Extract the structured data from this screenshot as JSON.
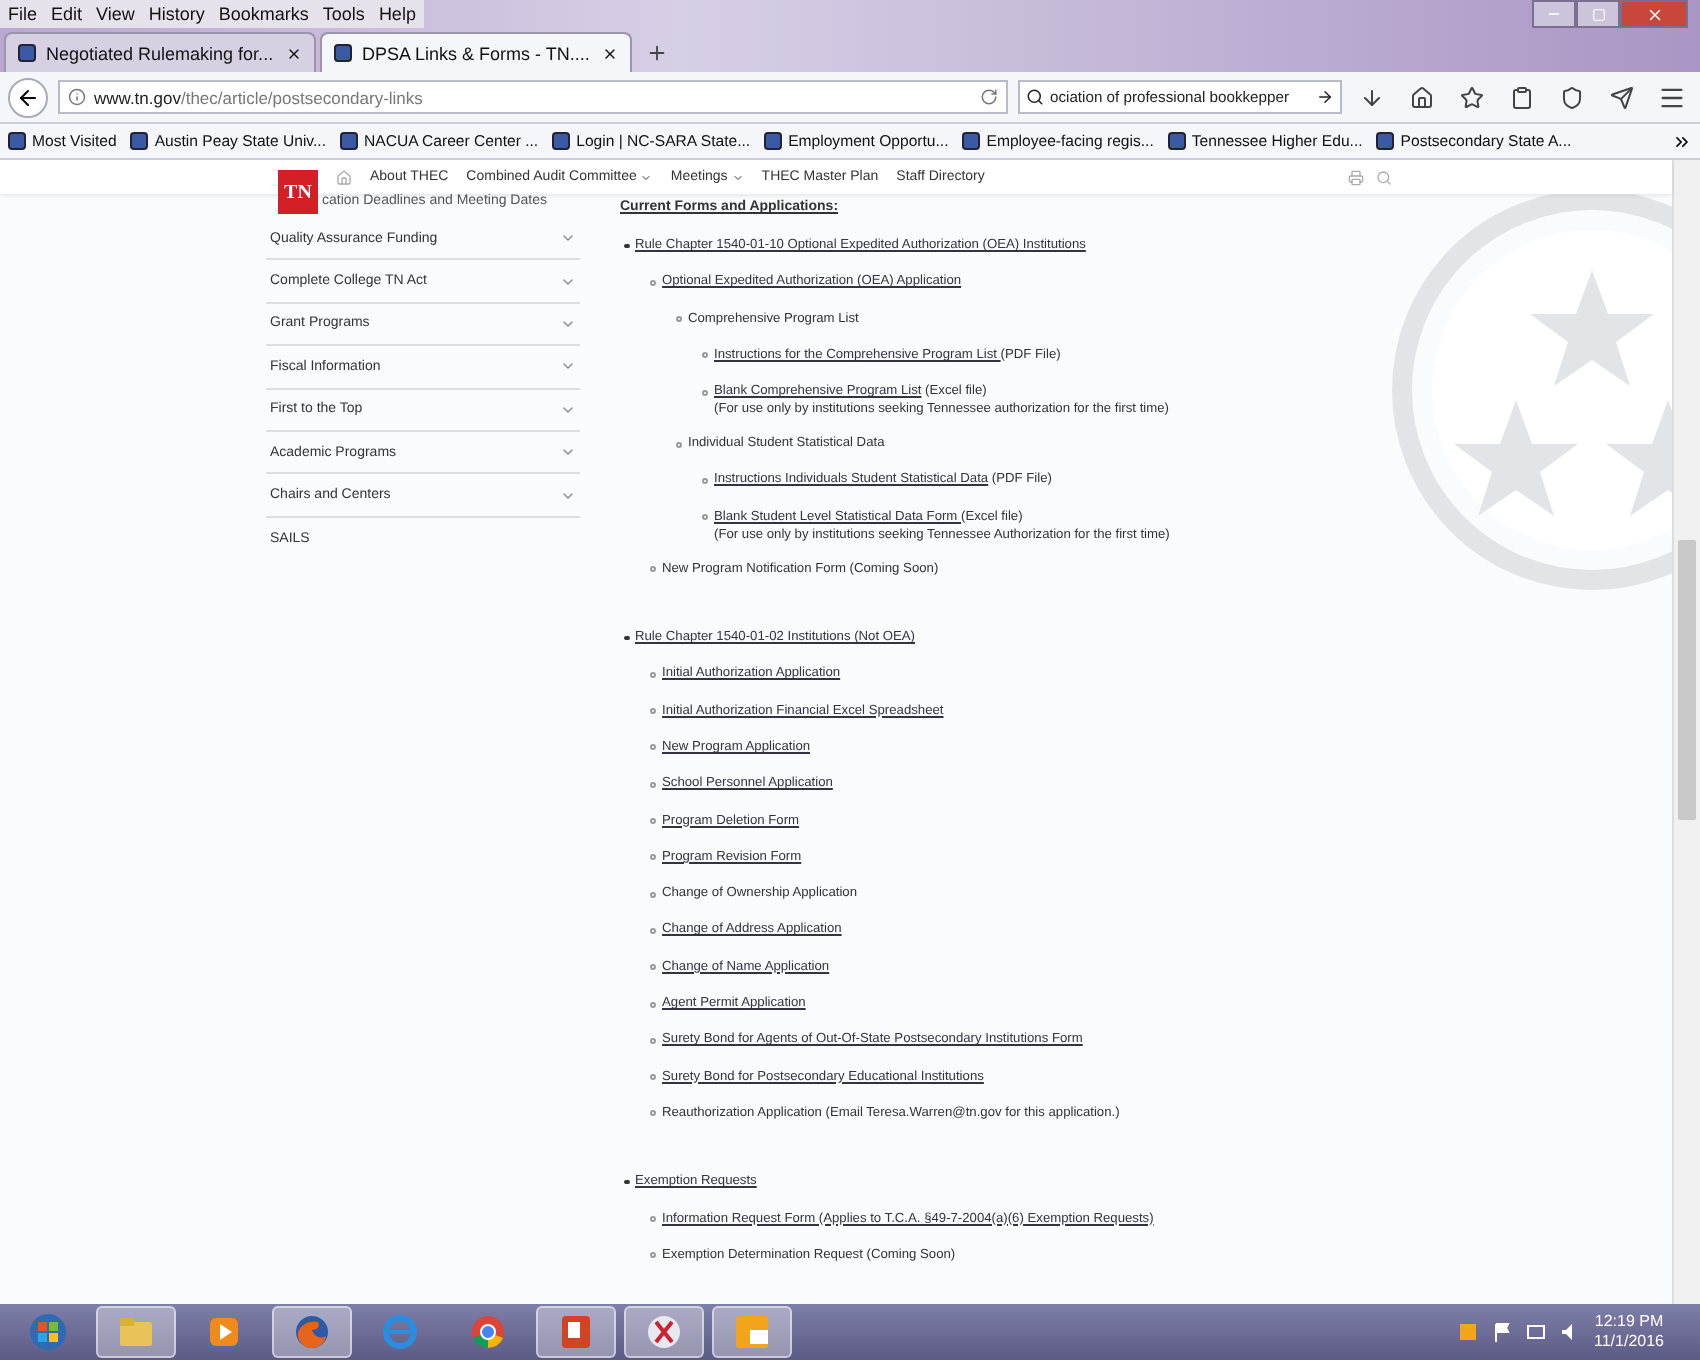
{
  "menu": [
    "File",
    "Edit",
    "View",
    "History",
    "Bookmarks",
    "Tools",
    "Help"
  ],
  "tabs": [
    {
      "label": "Negotiated Rulemaking for...",
      "selected": false
    },
    {
      "label": "DPSA Links & Forms - TN....",
      "selected": true
    }
  ],
  "address": {
    "url_host": "www.tn.gov",
    "url_path": "/thec/article/postsecondary-links",
    "search": "ociation of professional bookkepper"
  },
  "bookmarks": [
    "Most Visited",
    "Austin Peay State Univ...",
    "NACUA Career Center ...",
    "Login | NC-SARA State...",
    "Employment Opportu...",
    "Employee-facing regis...",
    "Tennessee Higher Edu...",
    "Postsecondary State A..."
  ],
  "site": {
    "logo": "TN",
    "nav": [
      {
        "label": "About THEC",
        "dropdown": false
      },
      {
        "label": "Combined Audit Committee",
        "dropdown": true
      },
      {
        "label": "Meetings",
        "dropdown": true
      },
      {
        "label": "THEC Master Plan",
        "dropdown": false
      },
      {
        "label": "Staff Directory",
        "dropdown": false
      }
    ]
  },
  "sidebar": [
    {
      "label": "cation Deadlines and Meeting Dates",
      "expandable": false
    },
    {
      "label": "Quality Assurance Funding",
      "expandable": true
    },
    {
      "label": "Complete College TN Act",
      "expandable": true
    },
    {
      "label": "Grant Programs",
      "expandable": true
    },
    {
      "label": "Fiscal Information",
      "expandable": true
    },
    {
      "label": "First to the Top",
      "expandable": true
    },
    {
      "label": "Academic Programs",
      "expandable": true
    },
    {
      "label": "Chairs and Centers",
      "expandable": true
    },
    {
      "label": "SAILS",
      "expandable": false
    }
  ],
  "heading": "Current Forms and Applications:",
  "sections": [
    {
      "link": "Rule Chapter 1540-01-10 Optional Expedited Authorization (OEA) Institutions",
      "children": [
        {
          "link": "Optional Expedited Authorization (OEA) Application",
          "children": [
            {
              "text": "Comprehensive Program List",
              "children": [
                {
                  "link": "Instructions for the Comprehensive Program List ",
                  "suffix": "(PDF File)"
                },
                {
                  "link": "Blank Comprehensive Program List",
                  "suffix": " (Excel file)",
                  "note": "(For use only by institutions seeking Tennessee authorization for the first time)"
                }
              ]
            },
            {
              "text": "Individual Student Statistical Data",
              "children": [
                {
                  "link": "Instructions Individuals Student Statistical Data",
                  "suffix": " (PDF File)"
                },
                {
                  "link": "Blank Student Level Statistical Data Form ",
                  "suffix": "(Excel file)",
                  "note": "(For use only by institutions seeking Tennessee Authorization for the first time)"
                }
              ]
            }
          ]
        },
        {
          "text": "New Program Notification Form (Coming Soon)"
        }
      ]
    },
    {
      "link": "Rule Chapter 1540-01-02 Institutions (Not OEA)",
      "children": [
        {
          "link": "Initial Authorization Application"
        },
        {
          "link": "Initial Authorization Financial Excel Spreadsheet"
        },
        {
          "link": "New Program Application"
        },
        {
          "link": "School Personnel Application"
        },
        {
          "link": "Program Deletion Form"
        },
        {
          "link": "Program Revision Form"
        },
        {
          "text": "Change of Ownership Application"
        },
        {
          "link": "Change of Address Application"
        },
        {
          "link": "Change of Name Application"
        },
        {
          "link": "Agent Permit Application"
        },
        {
          "link": "Surety Bond for Agents of Out-Of-State Postsecondary Institutions Form"
        },
        {
          "link": "Surety Bond for Postsecondary Educational Institutions"
        },
        {
          "text": "Reauthorization Application (Email Teresa.Warren@tn.gov for this application.)"
        }
      ]
    },
    {
      "link": "Exemption Requests",
      "children": [
        {
          "link": "Information Request Form (Applies to T.C.A. §49-7-2004(a)(6) Exemption Requests)"
        },
        {
          "text": "Exemption Determination Request (Coming Soon)"
        }
      ]
    }
  ],
  "clock": {
    "time": "12:19 PM",
    "date": "11/1/2016"
  }
}
